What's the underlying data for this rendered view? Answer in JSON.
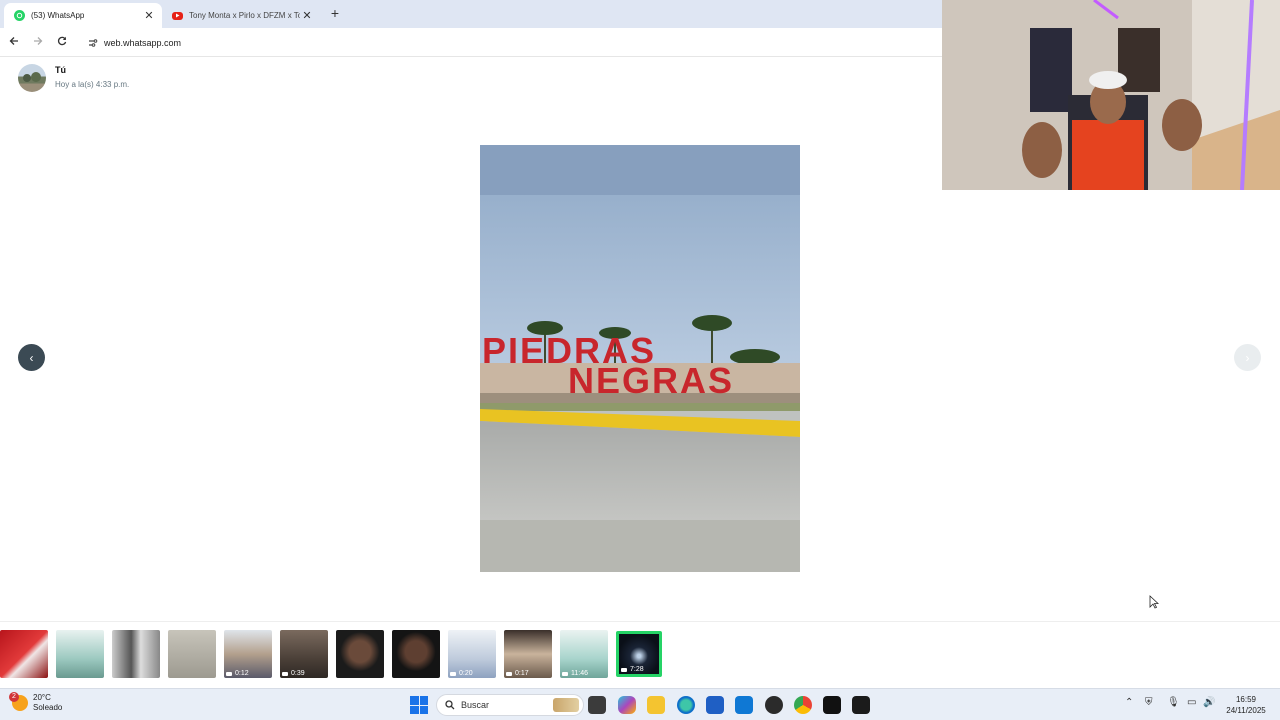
{
  "browser": {
    "tabs": [
      {
        "title": "(53) WhatsApp",
        "active": true,
        "favicon": "whatsapp-icon"
      },
      {
        "title": "Tony Monta x Pirlo x DFZM x To",
        "active": false,
        "favicon": "youtube-icon"
      }
    ],
    "url": "web.whatsapp.com"
  },
  "viewer": {
    "sender_name": "Tú",
    "sender_time": "Hoy a la(s) 4:33 p.m.",
    "thumbnails": [
      {
        "duration": "",
        "kind": "image"
      },
      {
        "duration": "",
        "kind": "image"
      },
      {
        "duration": "",
        "kind": "image"
      },
      {
        "duration": "",
        "kind": "image"
      },
      {
        "duration": "0:12",
        "kind": "video"
      },
      {
        "duration": "0:39",
        "kind": "video"
      },
      {
        "duration": "",
        "kind": "image"
      },
      {
        "duration": "",
        "kind": "image"
      },
      {
        "duration": "0:20",
        "kind": "video"
      },
      {
        "duration": "0:17",
        "kind": "video"
      },
      {
        "duration": "11:46",
        "kind": "video"
      },
      {
        "duration": "7:28",
        "kind": "video"
      }
    ],
    "selected_index": 11
  },
  "taskbar": {
    "weather_temp": "20°C",
    "weather_desc": "Soleado",
    "weather_badge": "2",
    "search_placeholder": "Buscar",
    "time": "16:59",
    "date": "24/11/2025"
  },
  "colors": {
    "whatsapp_green": "#25d366",
    "tab_strip": "#dfe6f3",
    "prev_arrow": "#3b4a54"
  }
}
